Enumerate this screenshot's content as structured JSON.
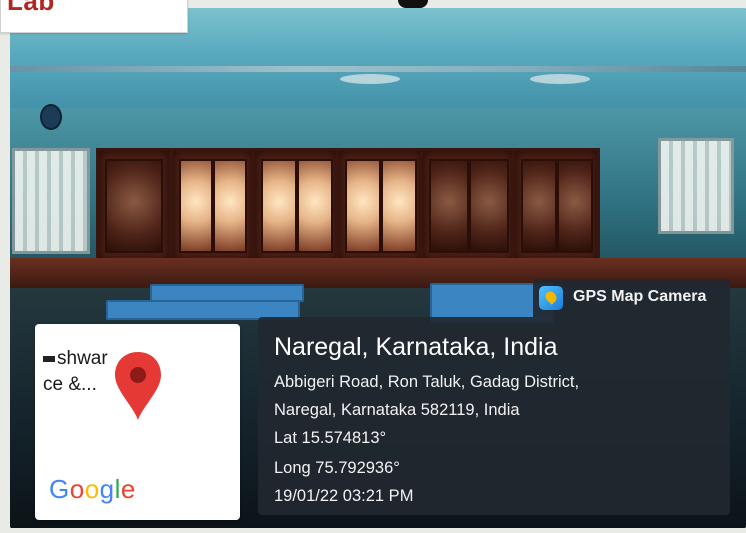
{
  "label_tag": {
    "text": "Lab"
  },
  "map_card": {
    "place_line1": "shwar",
    "place_line2": "ce &...",
    "logo_text": "Google",
    "logo_colors": [
      "#4285F4",
      "#EA4335",
      "#FBBC05",
      "#4285F4",
      "#34A853",
      "#EA4335"
    ],
    "pin_color": "#e53935"
  },
  "gps_badge": {
    "label": "GPS Map Camera",
    "icon": "gps-map-camera-icon"
  },
  "location": {
    "title": "Naregal, Karnataka, India",
    "address_line1": "Abbigeri Road, Ron Taluk, Gadag District,",
    "address_line2": "Naregal, Karnataka 582119, India",
    "lat": "Lat 15.574813°",
    "long": "Long 75.792936°",
    "timestamp": "19/01/22 03:21 PM"
  }
}
